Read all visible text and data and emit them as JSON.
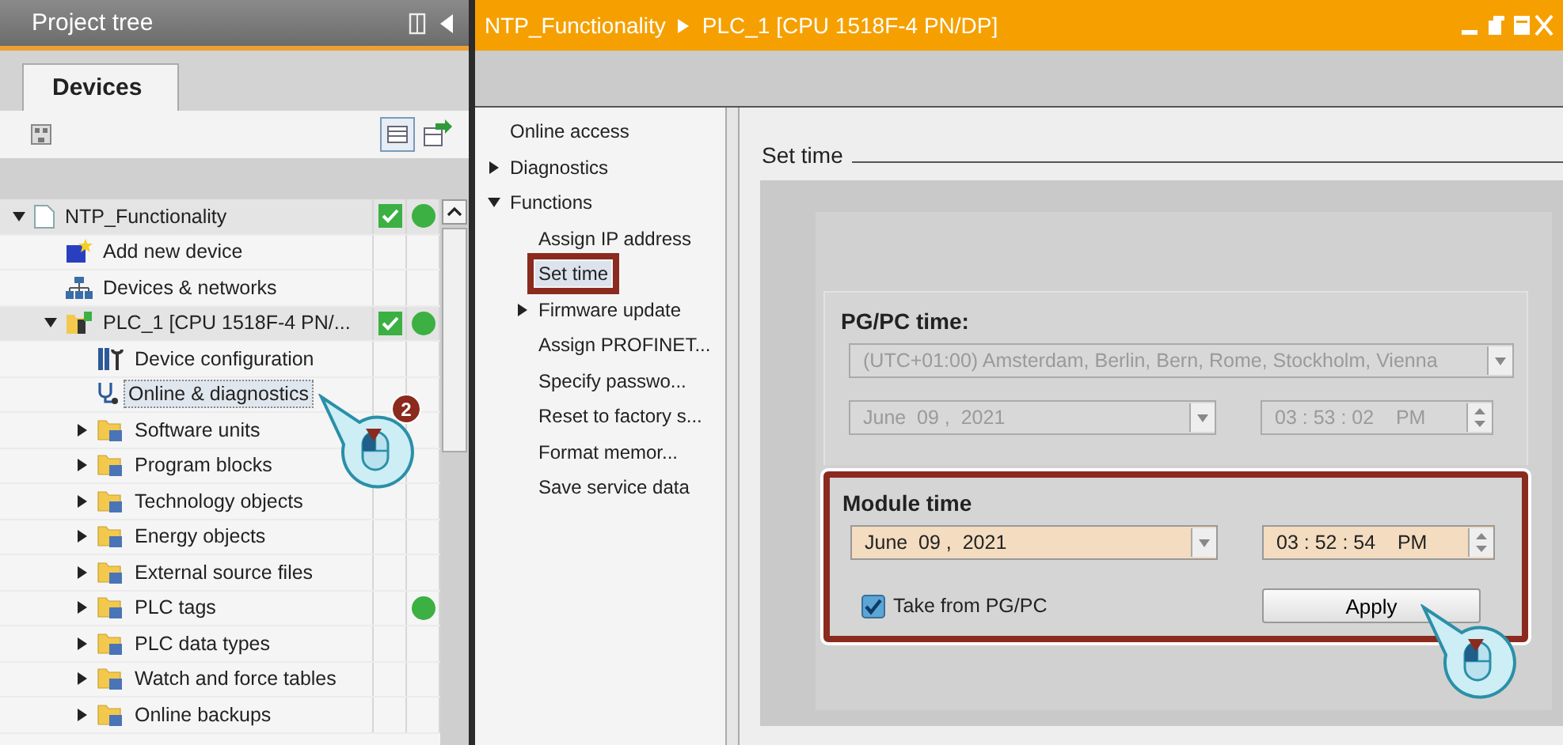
{
  "project_tree": {
    "title": "Project tree",
    "tabs": [
      {
        "label": "Devices",
        "selected": true
      }
    ],
    "items": [
      {
        "kind": "project",
        "label": "NTP_Functionality",
        "expanded": true,
        "compiled": true,
        "online": true,
        "selected": false,
        "children": [
          {
            "kind": "add-device",
            "label": "Add new device",
            "compiled": false,
            "online": false,
            "selected": false
          },
          {
            "kind": "network",
            "label": "Devices & networks",
            "compiled": false,
            "online": false,
            "selected": false
          },
          {
            "kind": "plc",
            "label": "PLC_1 [CPU 1518F-4 PN/...",
            "expanded": true,
            "compiled": true,
            "online": true,
            "selected": false,
            "children": [
              {
                "kind": "config",
                "label": "Device configuration",
                "compiled": false,
                "online": false,
                "selected": false
              },
              {
                "kind": "diagnostics",
                "label": "Online & diagnostics",
                "compiled": false,
                "online": false,
                "selected": true,
                "step": "2"
              },
              {
                "kind": "folder",
                "label": "Software units",
                "expanded": false,
                "compiled": false,
                "online": false,
                "selected": false
              },
              {
                "kind": "folder",
                "label": "Program blocks",
                "expanded": false,
                "compiled": false,
                "online": false,
                "selected": false
              },
              {
                "kind": "folder",
                "label": "Technology objects",
                "expanded": false,
                "compiled": false,
                "online": false,
                "selected": false
              },
              {
                "kind": "folder",
                "label": "Energy objects",
                "expanded": false,
                "compiled": false,
                "online": false,
                "selected": false
              },
              {
                "kind": "folder",
                "label": "External source files",
                "expanded": false,
                "compiled": false,
                "online": false,
                "selected": false
              },
              {
                "kind": "folder",
                "label": "PLC tags",
                "expanded": false,
                "compiled": false,
                "online": true,
                "selected": false
              },
              {
                "kind": "folder",
                "label": "PLC data types",
                "expanded": false,
                "compiled": false,
                "online": false,
                "selected": false
              },
              {
                "kind": "folder",
                "label": "Watch and force tables",
                "expanded": false,
                "compiled": false,
                "online": false,
                "selected": false
              },
              {
                "kind": "folder",
                "label": "Online backups",
                "expanded": false,
                "compiled": false,
                "online": false,
                "selected": false
              }
            ]
          }
        ]
      }
    ]
  },
  "editor": {
    "breadcrumb": [
      "NTP_Functionality",
      "PLC_1 [CPU 1518F-4 PN/DP]"
    ],
    "nav": [
      {
        "label": "Online access",
        "selected": false
      },
      {
        "label": "Diagnostics",
        "expanded": false,
        "selected": false
      },
      {
        "label": "Functions",
        "expanded": true,
        "selected": false,
        "children": [
          {
            "label": "Assign IP address",
            "selected": false
          },
          {
            "label": "Set time",
            "selected": true
          },
          {
            "label": "Firmware update",
            "expanded": false,
            "selected": false
          },
          {
            "label": "Assign PROFINET...",
            "selected": false
          },
          {
            "label": "Specify passwo...",
            "selected": false
          },
          {
            "label": "Reset to factory s...",
            "selected": false
          },
          {
            "label": "Format memor...",
            "selected": false
          },
          {
            "label": "Save service data",
            "selected": false
          }
        ]
      }
    ],
    "section_title": "Set time",
    "pgpc": {
      "title": "PG/PC time:",
      "timezone": "(UTC+01:00) Amsterdam, Berlin, Bern, Rome, Stockholm, Vienna",
      "date": "June  09 ,  2021",
      "time": "03 : 53 : 02    PM",
      "disabled": true
    },
    "module": {
      "title": "Module time",
      "date": "June  09 ,  2021",
      "time": "03 : 52 : 54    PM",
      "disabled": false,
      "highlighted": true,
      "take_from_pgpc": {
        "label": "Take from PG/PC",
        "checked": true
      },
      "apply": {
        "label": "Apply",
        "click_hint": true
      }
    }
  }
}
